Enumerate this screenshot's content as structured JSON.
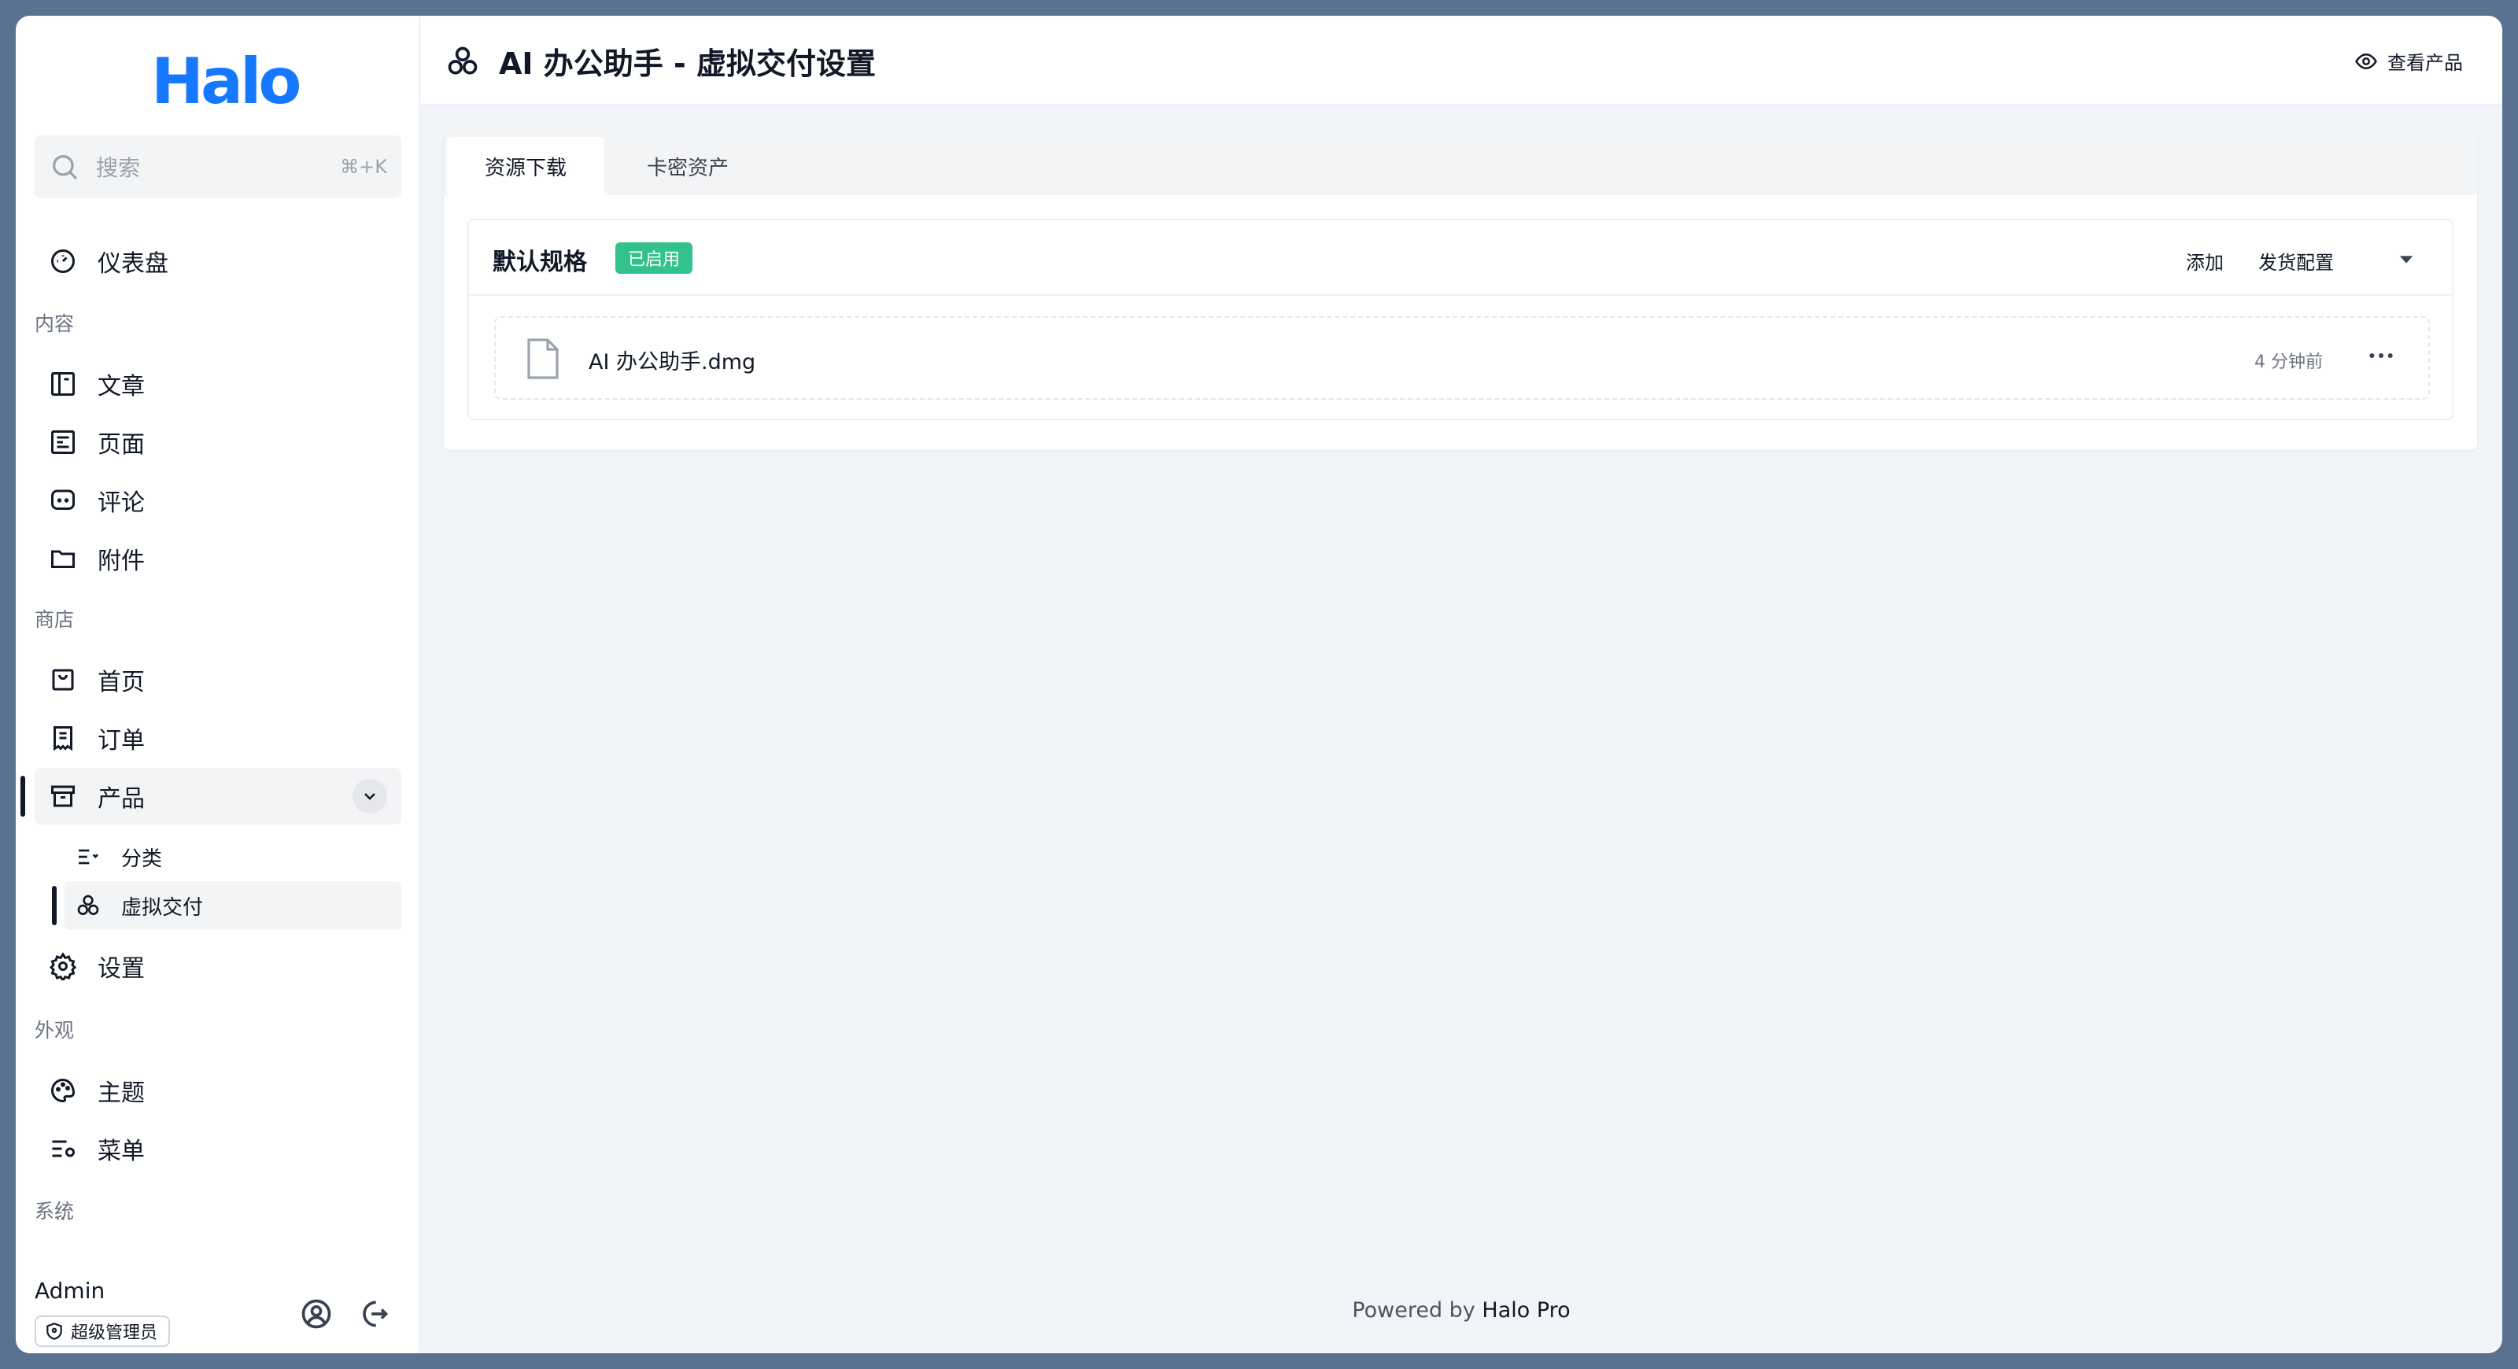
{
  "sidebar": {
    "logo": "Halo",
    "search": {
      "placeholder": "搜索",
      "shortcut": "⌘+K"
    },
    "dashboard": "仪表盘",
    "groups": {
      "content": "内容",
      "shop": "商店",
      "appearance": "外观",
      "system": "系统"
    },
    "content_items": [
      "文章",
      "页面",
      "评论",
      "附件"
    ],
    "shop_items": [
      "首页",
      "订单",
      "产品"
    ],
    "product_sub": [
      "分类",
      "虚拟交付"
    ],
    "settings": "设置",
    "appearance_items": [
      "主题",
      "菜单"
    ],
    "more": "···",
    "user": {
      "name": "Admin",
      "role": "超级管理员"
    }
  },
  "header": {
    "title": "AI 办公助手 - 虚拟交付设置",
    "view_product": "查看产品"
  },
  "tabs": [
    {
      "label": "资源下载",
      "active": true
    },
    {
      "label": "卡密资产",
      "active": false
    }
  ],
  "spec": {
    "title": "默认规格",
    "badge": "已启用",
    "add": "添加",
    "config": "发货配置",
    "files": [
      {
        "name": "AI 办公助手.dmg",
        "time": "4 分钟前"
      }
    ]
  },
  "footer": {
    "prefix": "Powered by ",
    "brand": "Halo Pro"
  },
  "colors": {
    "accent": "#1677ff",
    "badge": "#34c28c",
    "frame": "#5a7290"
  }
}
